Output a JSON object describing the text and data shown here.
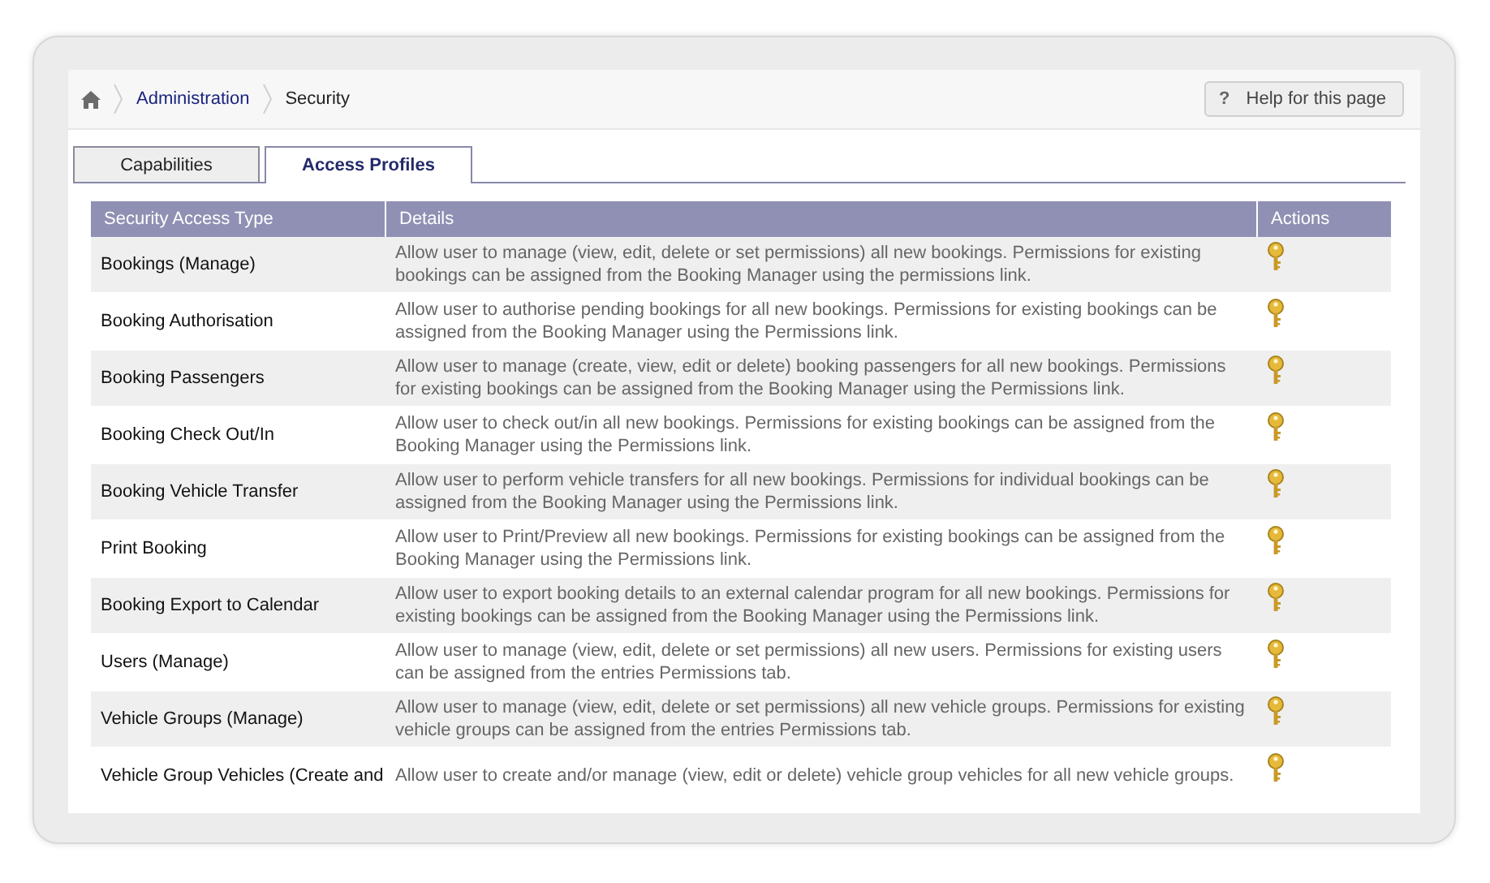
{
  "breadcrumb": [
    {
      "label": "Administration",
      "link": true
    },
    {
      "label": "Security",
      "link": false
    }
  ],
  "help_button": {
    "icon": "?",
    "label": "Help for this page"
  },
  "tabs": [
    {
      "label": "Capabilities",
      "selected": false
    },
    {
      "label": "Access Profiles",
      "selected": true
    }
  ],
  "table": {
    "columns": [
      "Security Access Type",
      "Details",
      "Actions"
    ],
    "rows": [
      {
        "type": "Bookings (Manage)",
        "details": "Allow user to manage (view, edit, delete or set permissions) all new bookings. Permissions for existing bookings can be assigned from the Booking Manager using the permissions link."
      },
      {
        "type": "Booking Authorisation",
        "details": "Allow user to authorise pending bookings for all new bookings. Permissions for existing bookings can be assigned from the Booking Manager using the Permissions link."
      },
      {
        "type": "Booking Passengers",
        "details": "Allow user to manage (create, view, edit or delete) booking passengers for all new bookings. Permissions for existing bookings can be assigned from the Booking Manager using the Permissions link."
      },
      {
        "type": "Booking Check Out/In",
        "details": "Allow user to check out/in all new bookings. Permissions for existing bookings can be assigned from the Booking Manager using the Permissions link."
      },
      {
        "type": "Booking Vehicle Transfer",
        "details": "Allow user to perform vehicle transfers for all new bookings. Permissions for individual bookings can be assigned from the Booking Manager using the Permissions link."
      },
      {
        "type": "Print Booking",
        "details": "Allow user to Print/Preview all new bookings. Permissions for existing bookings can be assigned from the Booking Manager using the Permissions link."
      },
      {
        "type": "Booking Export to Calendar",
        "details": "Allow user to export booking details to an external calendar program for all new bookings. Permissions for existing bookings can be assigned from the Booking Manager using the Permissions link."
      },
      {
        "type": "Users (Manage)",
        "details": "Allow user to manage (view, edit, delete or set permissions) all new users. Permissions for existing users can be assigned from the entries Permissions tab."
      },
      {
        "type": "Vehicle Groups (Manage)",
        "details": "Allow user to manage (view, edit, delete or set permissions) all new vehicle groups. Permissions for existing vehicle groups can be assigned from the entries Permissions tab."
      },
      {
        "type": "Vehicle Group Vehicles (Create and",
        "details": "Allow user to create and/or manage (view, edit or delete) vehicle group vehicles for all new vehicle groups."
      }
    ]
  }
}
